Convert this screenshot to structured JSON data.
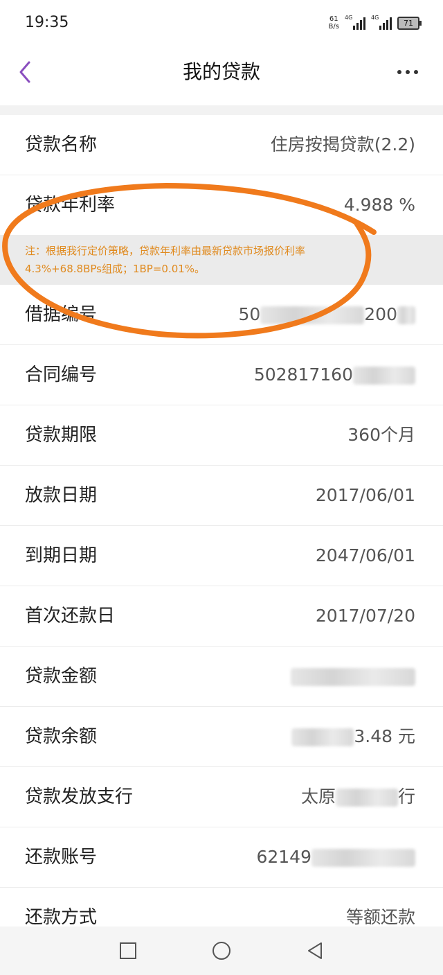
{
  "status_bar": {
    "time": "19:35",
    "net_speed_value": "61",
    "net_speed_unit": "B/s",
    "signal_labels": [
      "4G",
      "4G"
    ],
    "battery": "71"
  },
  "header": {
    "title": "我的贷款"
  },
  "loan": {
    "name_label": "贷款名称",
    "name_value": "住房按揭贷款(2.2)",
    "rate_label": "贷款年利率",
    "rate_value": "4.988 %",
    "note_line1": "注：根据我行定价策略，贷款年利率由最新贷款市场报价利率",
    "note_line2": "4.3%+68.8BPs组成；1BP=0.01%。",
    "receipt_label": "借据编号",
    "receipt_value_start": "50",
    "receipt_value_end": "200",
    "contract_label": "合同编号",
    "contract_value": "502817160",
    "term_label": "贷款期限",
    "term_value": "360个月",
    "disburse_label": "放款日期",
    "disburse_value": "2017/06/01",
    "maturity_label": "到期日期",
    "maturity_value": "2047/06/01",
    "first_repay_label": "首次还款日",
    "first_repay_value": "2017/07/20",
    "amount_label": "贷款金额",
    "balance_label": "贷款余额",
    "balance_value": "3.48 元",
    "branch_label": "贷款发放支行",
    "branch_value_start": "太原",
    "branch_value_end": "行",
    "account_label": "还款账号",
    "account_value": "62149",
    "method_label": "还款方式",
    "method_value": "等额还款"
  },
  "colors": {
    "accent": "#8a4fbf",
    "note_text": "#e08a1e",
    "annotation": "#f07a1c"
  }
}
